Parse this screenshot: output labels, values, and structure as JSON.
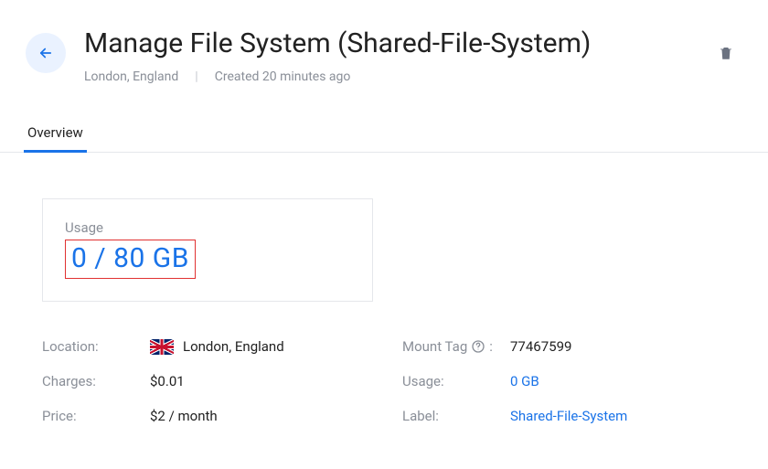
{
  "header": {
    "title": "Manage File System (Shared-File-System)",
    "location": "London, England",
    "created": "Created 20 minutes ago"
  },
  "tabs": {
    "overview": "Overview"
  },
  "usage_card": {
    "label": "Usage",
    "value": "0 / 80 GB"
  },
  "details": {
    "left": {
      "location_k": "Location:",
      "location_v": "London, England",
      "charges_k": "Charges:",
      "charges_v": "$0.01",
      "price_k": "Price:",
      "price_v": "$2 / month"
    },
    "right": {
      "mount_k": "Mount Tag",
      "mount_colon": ":",
      "mount_v": "77467599",
      "usage_k": "Usage:",
      "usage_v": "0 GB",
      "label_k": "Label:",
      "label_v": "Shared-File-System"
    }
  }
}
